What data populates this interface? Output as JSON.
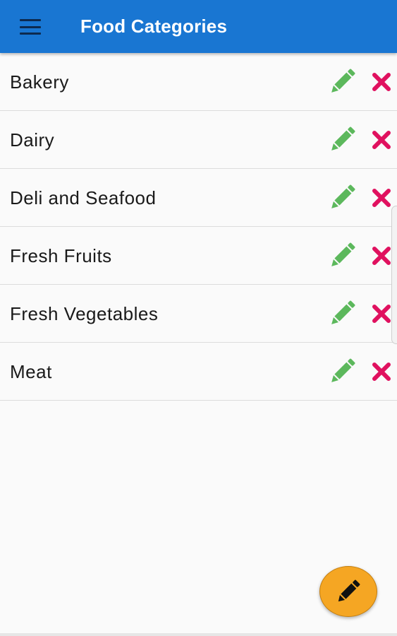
{
  "app_bar": {
    "title": "Food Categories",
    "menu_icon": "hamburger-menu-icon",
    "background_color": "#1976d2"
  },
  "categories": [
    {
      "label": "Bakery"
    },
    {
      "label": "Dairy"
    },
    {
      "label": "Deli and Seafood"
    },
    {
      "label": "Fresh Fruits"
    },
    {
      "label": "Fresh Vegetables"
    },
    {
      "label": "Meat"
    }
  ],
  "row_actions": {
    "edit_icon": "pencil-icon",
    "edit_color": "#5cb85c",
    "delete_icon": "close-icon",
    "delete_color": "#e0115f"
  },
  "fab": {
    "icon": "pencil-icon",
    "color": "#f5a623"
  }
}
